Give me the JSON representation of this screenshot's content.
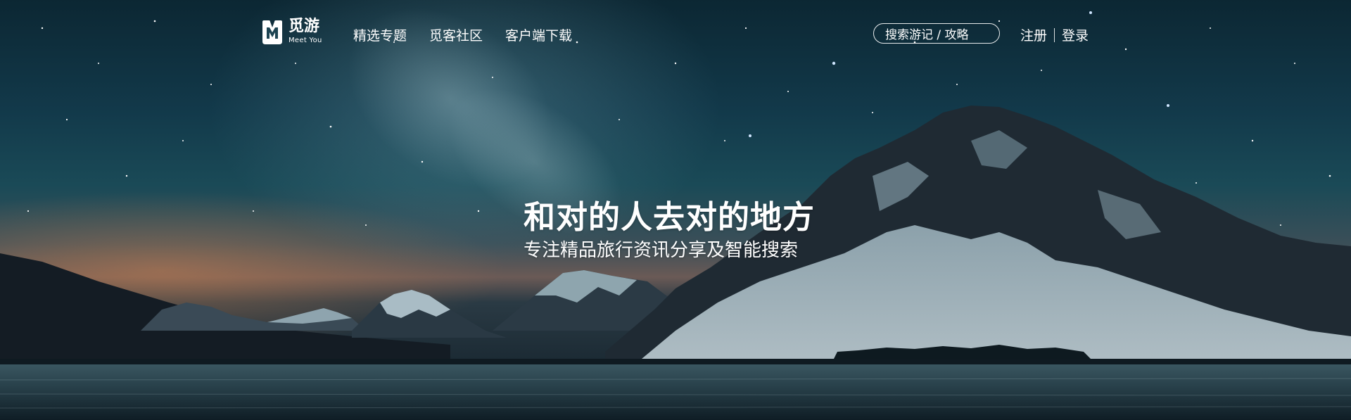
{
  "brand": {
    "name_cn": "觅游",
    "name_en": "Meet You"
  },
  "nav": {
    "items": [
      {
        "label": "精选专题"
      },
      {
        "label": "觅客社区"
      },
      {
        "label": "客户端下载"
      }
    ]
  },
  "search": {
    "placeholder": "搜索游记 / 攻略"
  },
  "auth": {
    "register_label": "注册",
    "login_label": "登录"
  },
  "hero": {
    "headline": "和对的人去对的地方",
    "subline": "专注精品旅行资讯分享及智能搜索",
    "background": "starry-sky-snowy-mountain-lake"
  },
  "colors": {
    "text": "#ffffff",
    "sky_top": "#0c2733",
    "sky_mid": "#1a4a57",
    "horizon_glow": "#c47e50"
  }
}
